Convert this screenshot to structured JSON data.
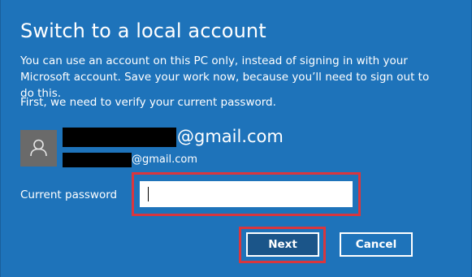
{
  "dialog": {
    "title": "Switch to a local account",
    "description": "You can use an account on this PC only, instead of signing in with your Microsoft account. Save your work now, because you’ll need to sign out to do this.",
    "verify_text": "First, we need to verify your current password."
  },
  "account": {
    "email_main_suffix": "@gmail.com",
    "email_sub_suffix": "@gmail.com",
    "avatar_icon": "user-icon"
  },
  "password": {
    "label": "Current password",
    "value": ""
  },
  "buttons": {
    "next_label": "Next",
    "cancel_label": "Cancel"
  },
  "colors": {
    "background": "#1e73ba",
    "highlight": "#d9363e",
    "next_button": "#1b5589"
  }
}
